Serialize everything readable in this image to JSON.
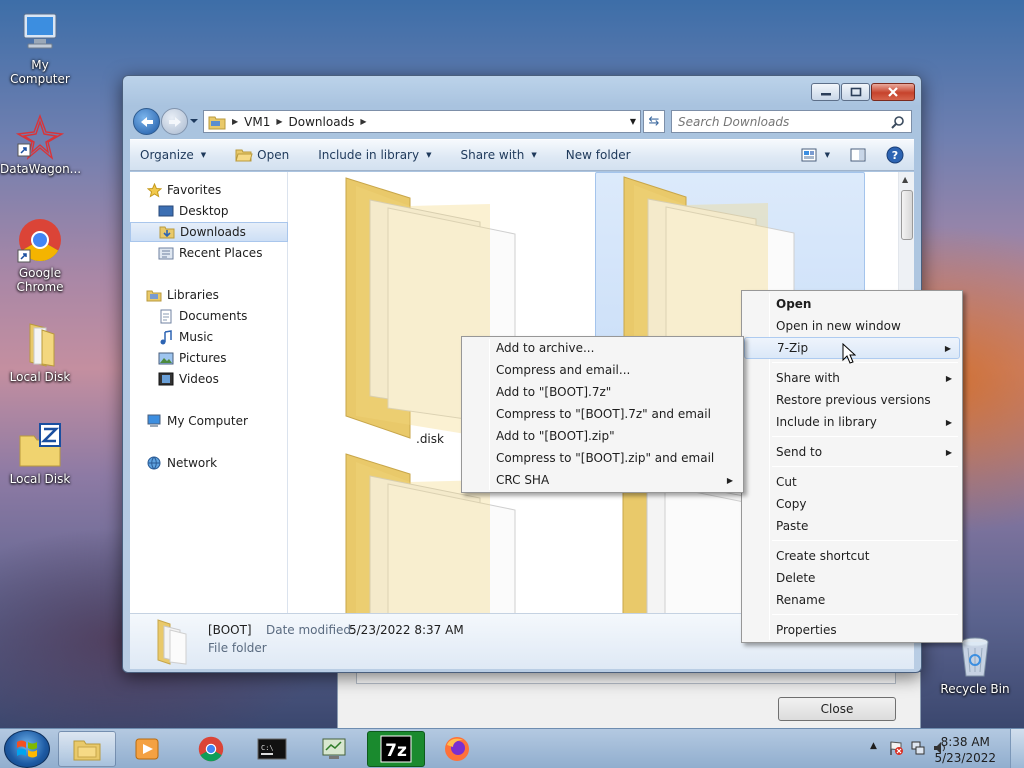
{
  "desktop": {
    "icons": [
      {
        "label": "My Computer"
      },
      {
        "label": "DataWagon..."
      },
      {
        "label": "Google Chrome"
      },
      {
        "label": "Local Disk"
      },
      {
        "label": "Local Disk"
      },
      {
        "label": "Recycle Bin"
      }
    ]
  },
  "explorer": {
    "breadcrumb": [
      "VM1",
      "Downloads"
    ],
    "search_placeholder": "Search Downloads",
    "commands": {
      "organize": "Organize",
      "open": "Open",
      "include": "Include in library",
      "share": "Share with",
      "newfolder": "New folder"
    },
    "nav": {
      "favorites": "Favorites",
      "desktop": "Desktop",
      "downloads": "Downloads",
      "recent": "Recent Places",
      "libraries": "Libraries",
      "documents": "Documents",
      "music": "Music",
      "pictures": "Pictures",
      "videos": "Videos",
      "computer": "My Computer",
      "network": "Network"
    },
    "files": [
      {
        "label": ".disk"
      }
    ],
    "details": {
      "name": "[BOOT]",
      "modified_label": "Date modified:",
      "modified": "5/23/2022 8:37 AM",
      "type": "File folder"
    }
  },
  "context_menu": {
    "items": {
      "open": "Open",
      "open_new": "Open in new window",
      "sevenzip": "7-Zip",
      "share": "Share with",
      "restore": "Restore previous versions",
      "include": "Include in library",
      "sendto": "Send to",
      "cut": "Cut",
      "copy": "Copy",
      "paste": "Paste",
      "shortcut": "Create shortcut",
      "delete": "Delete",
      "rename": "Rename",
      "properties": "Properties"
    }
  },
  "sevenzip_menu": {
    "items": {
      "add": "Add to archive...",
      "compress_email": "Compress and email...",
      "add7z": "Add to \"[BOOT].7z\"",
      "compress7z": "Compress to \"[BOOT].7z\" and email",
      "addzip": "Add to \"[BOOT].zip\"",
      "compresszip": "Compress to \"[BOOT].zip\" and email",
      "crc": "CRC SHA"
    }
  },
  "dialog": {
    "close_label": "Close"
  },
  "taskbar": {
    "time": "8:38 AM",
    "date": "5/23/2022"
  }
}
